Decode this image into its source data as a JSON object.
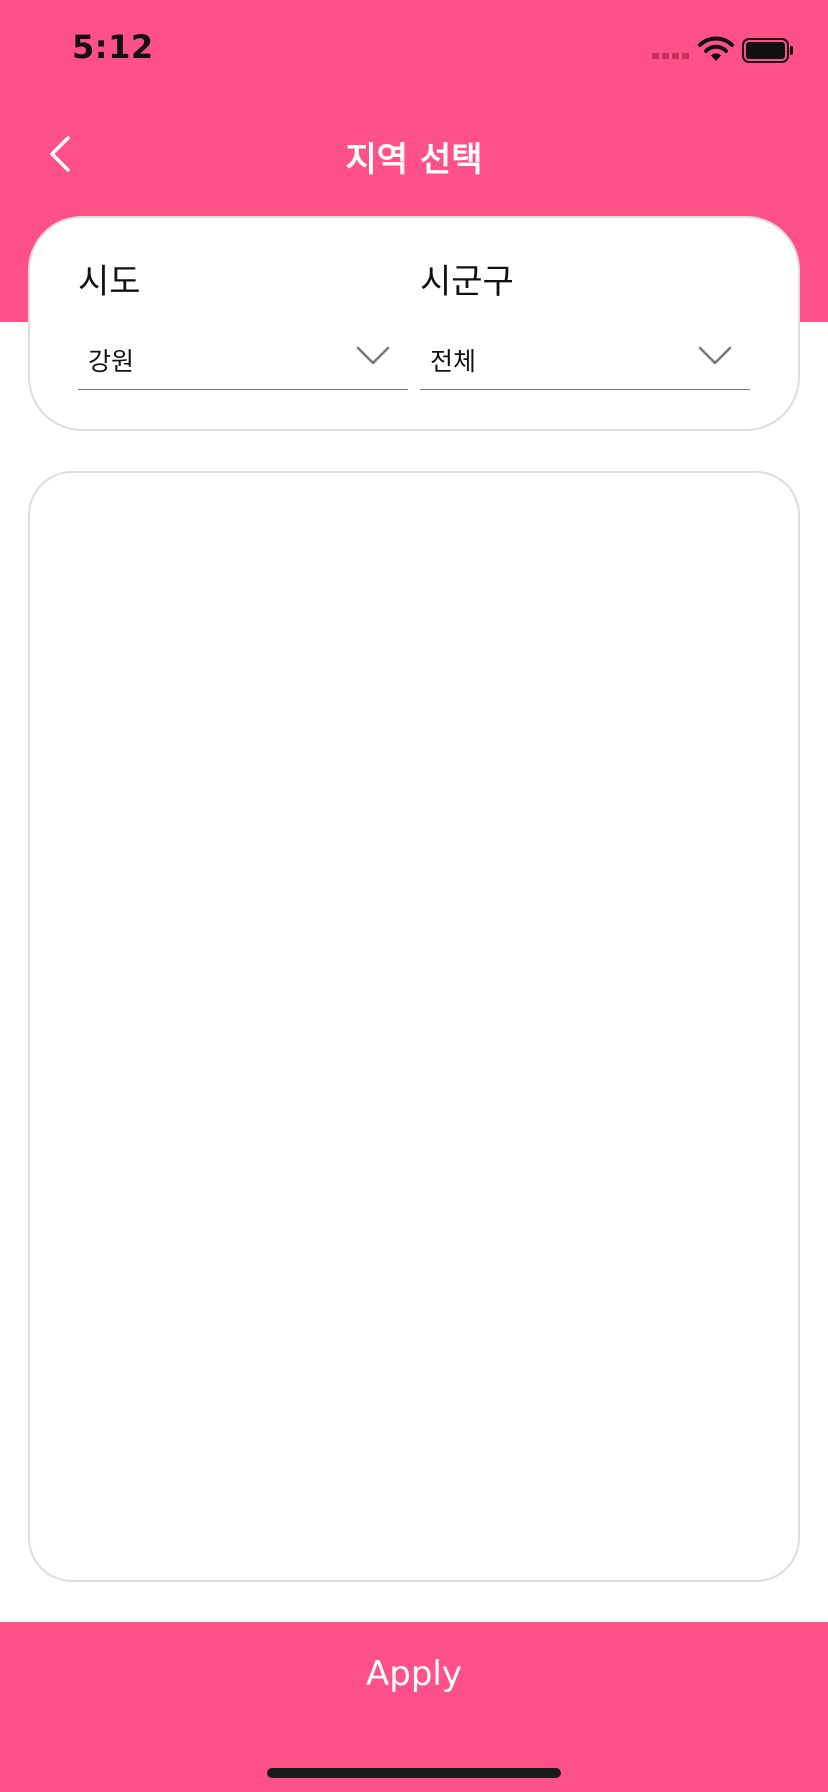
{
  "status_bar": {
    "time": "5:12"
  },
  "nav": {
    "title": "지역 선택",
    "back_icon": "chevron-left-icon"
  },
  "region": {
    "sido": {
      "label": "시도",
      "selected": "강원"
    },
    "sigungu": {
      "label": "시군구",
      "selected": "전체"
    }
  },
  "footer": {
    "apply_label": "Apply"
  },
  "colors": {
    "brand": "#FF5089",
    "border": "#dddddd"
  }
}
